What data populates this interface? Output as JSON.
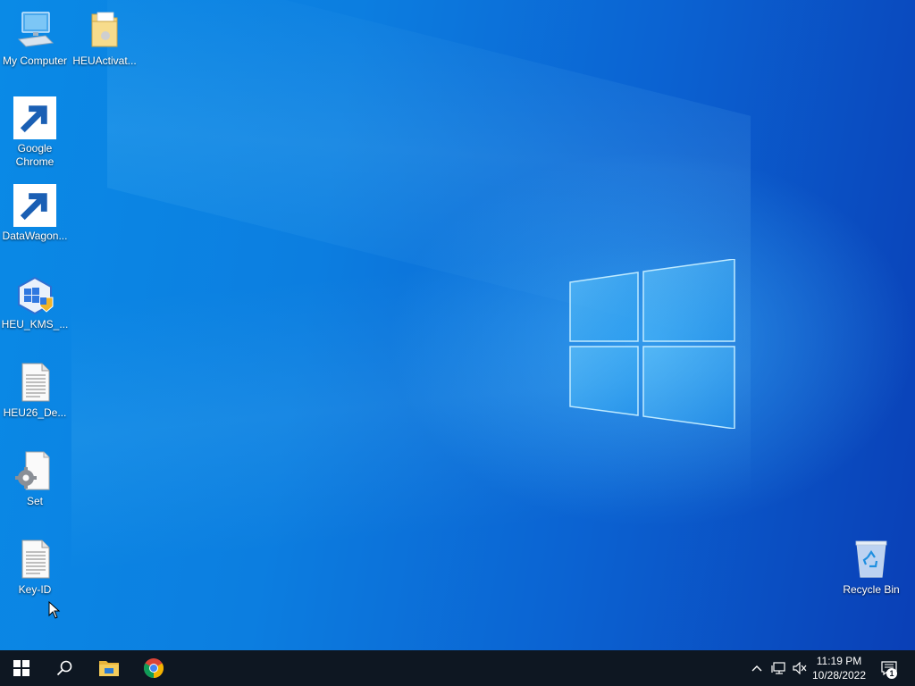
{
  "desktop": {
    "icons": [
      {
        "label": "My Computer",
        "icon": "computer-icon"
      },
      {
        "label": "HEUActivat...",
        "icon": "folder-icon"
      },
      {
        "label": "Google Chrome",
        "icon": "chrome-icon",
        "shortcut": true
      },
      {
        "label": "DataWagon...",
        "icon": "datawagon-icon",
        "shortcut": true
      },
      {
        "label": "HEU_KMS_...",
        "icon": "heu-kms-icon"
      },
      {
        "label": "HEU26_De...",
        "icon": "text-document-icon"
      },
      {
        "label": "Set",
        "icon": "settings-file-icon"
      },
      {
        "label": "Key-ID",
        "icon": "text-document-icon"
      },
      {
        "label": "Recycle Bin",
        "icon": "recycle-bin-icon"
      }
    ]
  },
  "taskbar": {
    "start": {
      "icon": "windows-start-icon"
    },
    "search": {
      "icon": "search-icon"
    },
    "pinned": [
      {
        "name": "File Explorer",
        "icon": "file-explorer-icon"
      },
      {
        "name": "Google Chrome",
        "icon": "chrome-icon"
      }
    ],
    "tray": {
      "icons": [
        "chevron-up-icon",
        "network-icon",
        "volume-muted-icon"
      ],
      "time": "11:19 PM",
      "date": "10/28/2022",
      "notification_count": "1"
    }
  },
  "colors": {
    "taskbar_bg": "#0e1722",
    "wallpaper_blue": "#0a7fe0"
  }
}
